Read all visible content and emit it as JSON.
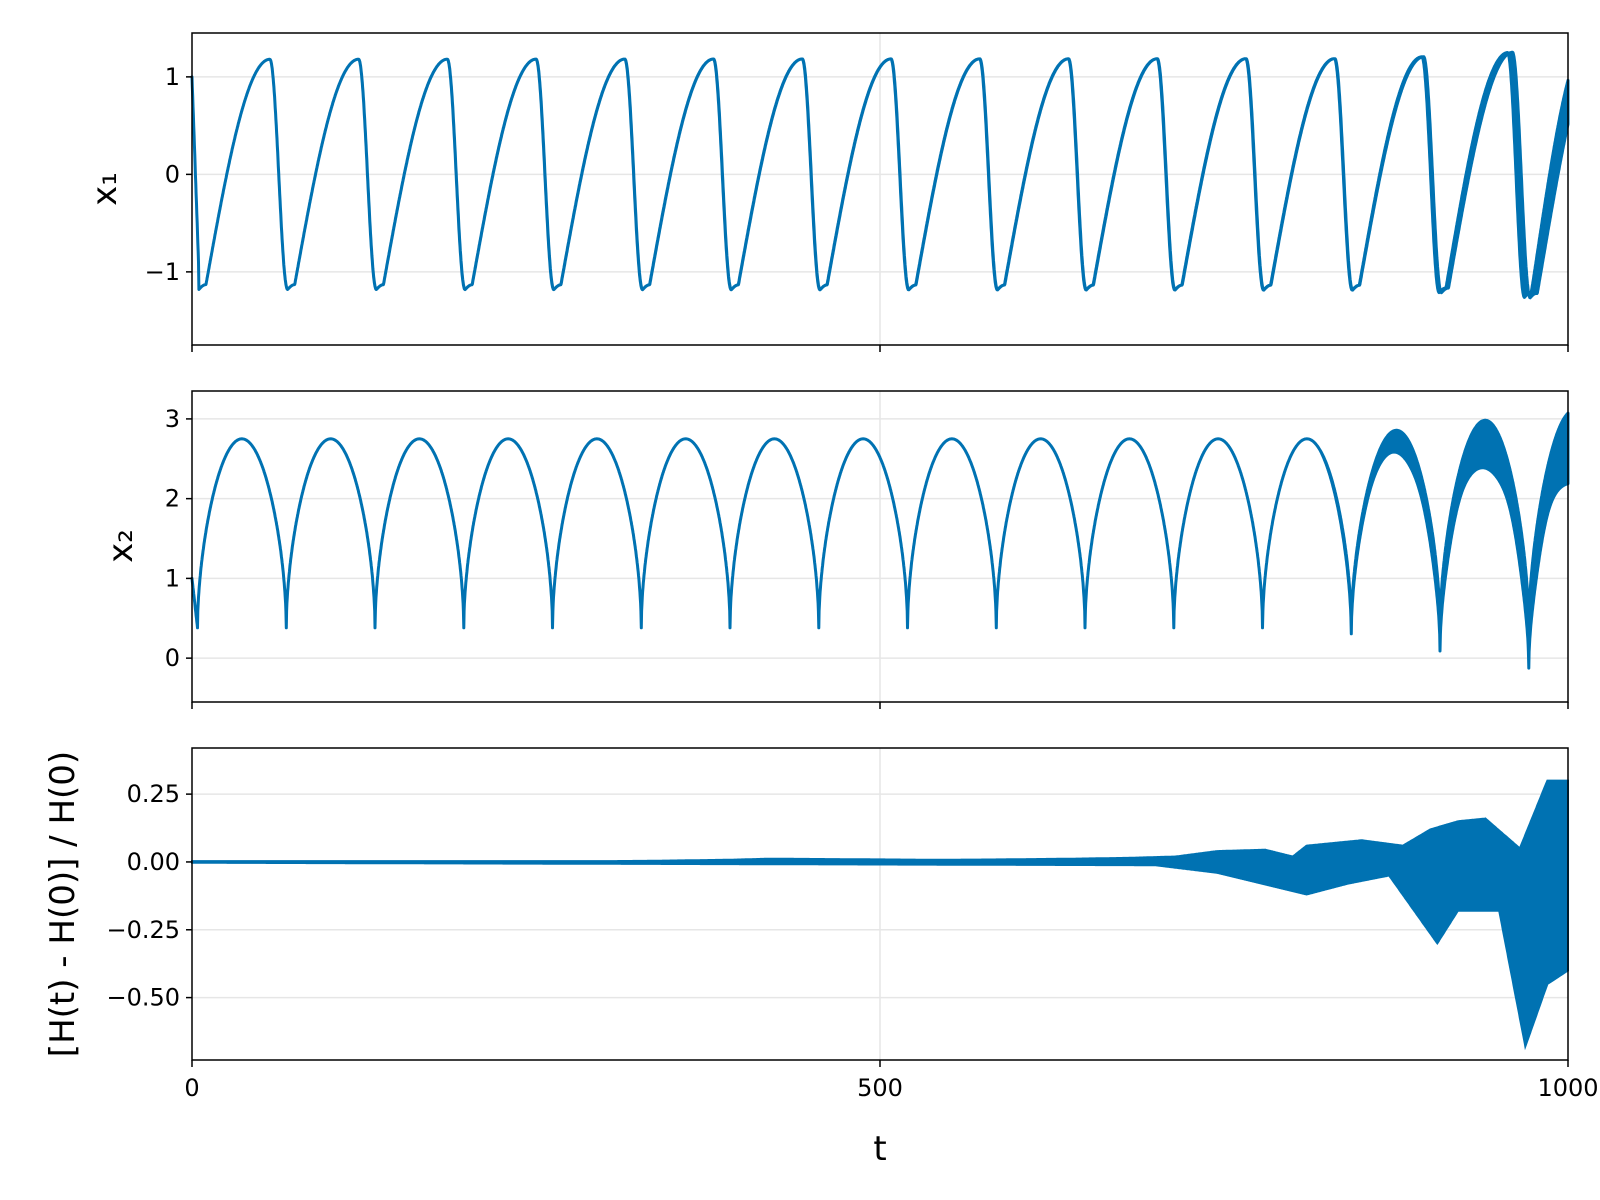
{
  "chart_data": [
    {
      "type": "line",
      "title": "",
      "xlabel": "",
      "ylabel": "x₁",
      "xlim": [
        0,
        1000
      ],
      "ylim": [
        -1.75,
        1.45
      ],
      "yticks": [
        1,
        0,
        -1
      ],
      "ytick_labels": [
        "1",
        "0",
        "−1"
      ],
      "xticks": [
        0,
        500,
        1000
      ],
      "grid": true,
      "color": "#0072b2",
      "series": [
        {
          "description_points": [
            [
              0,
              1.0
            ],
            [
              5,
              -1.0
            ],
            [
              12,
              -1.18
            ],
            [
              40,
              0.0
            ],
            [
              60,
              1.18
            ],
            [
              66,
              1.1
            ],
            [
              72,
              -0.9
            ],
            [
              76,
              -1.15
            ],
            [
              80,
              -1.18
            ]
          ],
          "period": 64.5,
          "amplitude_max": 1.18,
          "amplitude_min": -1.18,
          "envelope_growth": [
            [
              0,
              0.0
            ],
            [
              850,
              0.02
            ],
            [
              900,
              0.08
            ],
            [
              950,
              0.18
            ],
            [
              975,
              0.25
            ],
            [
              1000,
              0.45
            ]
          ]
        }
      ]
    },
    {
      "type": "line",
      "title": "",
      "xlabel": "",
      "ylabel": "x₂",
      "xlim": [
        0,
        1000
      ],
      "ylim": [
        -0.55,
        3.35
      ],
      "yticks": [
        3,
        2,
        1,
        0
      ],
      "ytick_labels": [
        "3",
        "2",
        "1",
        "0"
      ],
      "xticks": [
        0,
        500,
        1000
      ],
      "grid": true,
      "color": "#0072b2",
      "series": [
        {
          "peak": 2.75,
          "minimum": 0.38,
          "period": 64.5,
          "first_min_t": 4,
          "late_peaks": [
            [
              870,
              2.8
            ],
            [
              935,
              2.95
            ],
            [
              1000,
              3.15
            ]
          ],
          "late_minimums": [
            [
              840,
              0.24
            ],
            [
              905,
              0.03
            ],
            [
              969,
              -0.38
            ]
          ]
        }
      ]
    },
    {
      "type": "area",
      "title": "",
      "xlabel": "t",
      "ylabel": "[H(t) - H(0)] / H(0)",
      "xlim": [
        0,
        1000
      ],
      "ylim": [
        -0.73,
        0.42
      ],
      "yticks": [
        0.25,
        0.0,
        -0.25,
        -0.5
      ],
      "ytick_labels": [
        "0.25",
        "0.00",
        "−0.25",
        "−0.50"
      ],
      "xticks": [
        0,
        500,
        1000
      ],
      "xtick_labels": [
        "0",
        "500",
        "1000"
      ],
      "grid": true,
      "color": "#0072b2",
      "series": [
        {
          "envelope": [
            [
              0,
              0.003
            ],
            [
              300,
              0.003
            ],
            [
              330,
              0.004
            ],
            [
              390,
              0.008
            ],
            [
              420,
              0.012
            ],
            [
              480,
              0.01
            ],
            [
              540,
              0.008
            ],
            [
              580,
              0.009
            ],
            [
              640,
              0.012
            ],
            [
              680,
              0.015
            ],
            [
              715,
              0.02
            ],
            [
              745,
              0.04
            ],
            [
              780,
              0.045
            ],
            [
              800,
              0.02
            ],
            [
              810,
              0.06
            ],
            [
              850,
              0.08
            ],
            [
              880,
              0.06
            ],
            [
              900,
              0.12
            ],
            [
              920,
              0.15
            ],
            [
              940,
              0.16
            ],
            [
              965,
              0.05
            ],
            [
              985,
              0.3
            ],
            [
              1000,
              0.3
            ]
          ],
          "lower_envelope": [
            [
              0,
              -0.003
            ],
            [
              700,
              -0.012
            ],
            [
              745,
              -0.04
            ],
            [
              810,
              -0.12
            ],
            [
              840,
              -0.08
            ],
            [
              870,
              -0.05
            ],
            [
              905,
              -0.3
            ],
            [
              920,
              -0.18
            ],
            [
              950,
              -0.18
            ],
            [
              969,
              -0.68
            ],
            [
              985,
              -0.45
            ],
            [
              1000,
              -0.4
            ]
          ]
        }
      ]
    }
  ]
}
